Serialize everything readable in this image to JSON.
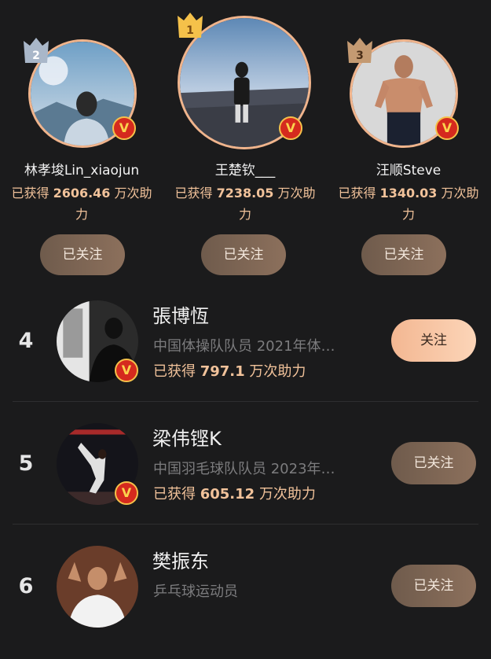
{
  "colors": {
    "background": "#1b1b1c",
    "accent": "#f1c29a",
    "gold_badge": "#f5c14a",
    "silver_badge": "#a9b7c9",
    "bronze_badge": "#c49a72",
    "verified_badge": "#d52a1e"
  },
  "verified_mark": "V",
  "podium": [
    {
      "rank": "2",
      "name": "林孝埈Lin_xiaojun",
      "score_prefix": "已获得",
      "score_value": "2606.46",
      "score_suffix": "万次助力",
      "follow_label": "已关注",
      "badge_color": "#a9b7c9"
    },
    {
      "rank": "1",
      "name": "王楚钦___",
      "score_prefix": "已获得",
      "score_value": "7238.05",
      "score_suffix": "万次助力",
      "follow_label": "已关注",
      "badge_color": "#f5c14a"
    },
    {
      "rank": "3",
      "name": "汪顺Steve",
      "score_prefix": "已获得",
      "score_value": "1340.03",
      "score_suffix": "万次助力",
      "follow_label": "已关注",
      "badge_color": "#c49a72"
    }
  ],
  "list": [
    {
      "rank": "4",
      "name": "張博恆",
      "desc": "中国体操队队员 2021年体…",
      "score_prefix": "已获得",
      "score_value": "797.1",
      "score_suffix": "万次助力",
      "follow_label": "关注",
      "followed": false
    },
    {
      "rank": "5",
      "name": "梁伟铿K",
      "desc": "中国羽毛球队队员 2023年…",
      "score_prefix": "已获得",
      "score_value": "605.12",
      "score_suffix": "万次助力",
      "follow_label": "已关注",
      "followed": true
    },
    {
      "rank": "6",
      "name": "樊振东",
      "desc": "乒乓球运动员",
      "score_prefix": "",
      "score_value": "",
      "score_suffix": "",
      "follow_label": "已关注",
      "followed": true
    }
  ]
}
